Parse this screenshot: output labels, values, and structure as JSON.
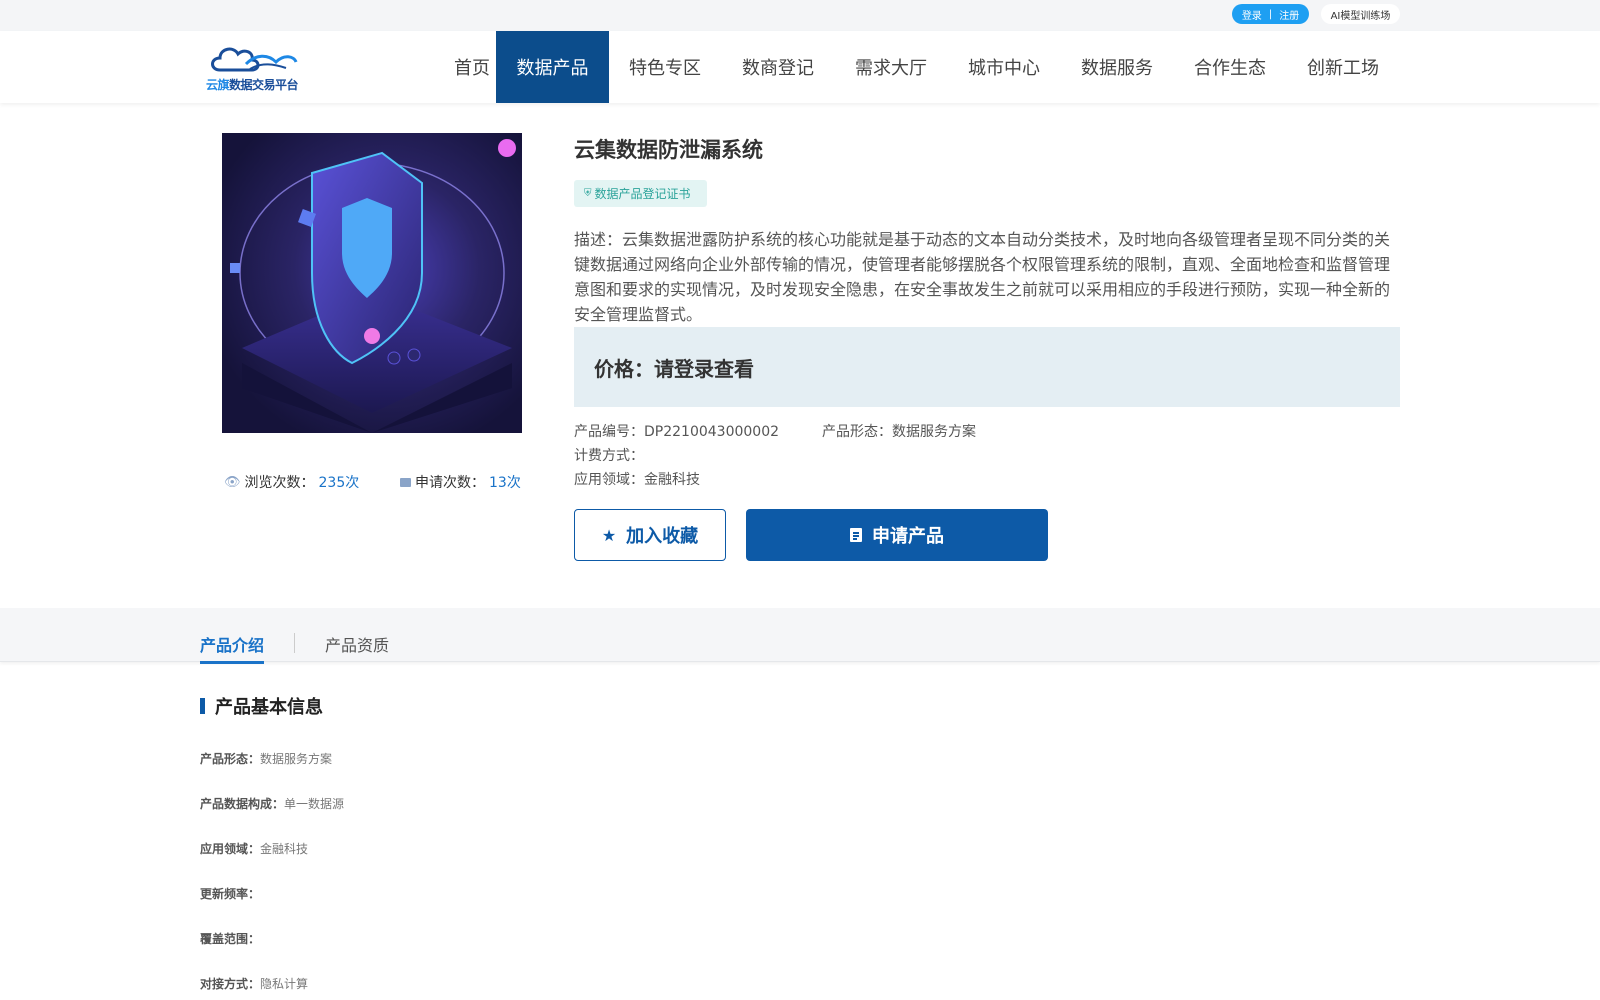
{
  "topbar": {
    "login": "登录",
    "separator": "|",
    "register": "注册",
    "ai_link": "AI模型训练场"
  },
  "logo": {
    "text_accent": "云旗",
    "text_rest": "数据交易平台"
  },
  "nav": {
    "items": [
      "首页",
      "数据产品",
      "特色专区",
      "数商登记",
      "需求大厅",
      "城市中心",
      "数据服务",
      "合作生态",
      "创新工场"
    ],
    "active": "数据产品"
  },
  "product": {
    "title": "云集数据防泄漏系统",
    "cert_label": "数据产品登记证书",
    "description": "描述：云集数据泄露防护系统的核心功能就是基于动态的文本自动分类技术，及时地向各级管理者呈现不同分类的关键数据通过网络向企业外部传输的情况，使管理者能够摆脱各个权限管理系统的限制，直观、全面地检查和监督管理意图和要求的实现情况，及时发现安全隐患，在安全事故发生之前就可以采用相应的手段进行预防，实现一种全新的安全管理监督式。",
    "price_text": "价格：请登录查看",
    "views_label": "浏览次数：",
    "views_value": "235次",
    "applies_label": "申请次数：",
    "applies_value": "13次",
    "code_label": "产品编号：",
    "code_value": "DP2210043000002",
    "form_label": "产品形态：",
    "form_value": "数据服务方案",
    "billing_label": "计费方式：",
    "billing_value": "",
    "domain_label": "应用领域：",
    "domain_value": "金融科技",
    "favorite_btn": "加入收藏",
    "apply_btn": "申请产品"
  },
  "tabs": {
    "intro": "产品介绍",
    "qualification": "产品资质"
  },
  "basic_info": {
    "title": "产品基本信息",
    "rows": [
      {
        "label": "产品形态：",
        "value": "数据服务方案"
      },
      {
        "label": "产品数据构成：",
        "value": "单一数据源"
      },
      {
        "label": "应用领域：",
        "value": "金融科技"
      },
      {
        "label": "更新频率：",
        "value": ""
      },
      {
        "label": "覆盖范围：",
        "value": ""
      },
      {
        "label": "对接方式：",
        "value": "隐私计算"
      }
    ]
  },
  "colors": {
    "primary": "#0d5aa7",
    "nav_active": "#0c4d8c",
    "accent_blue": "#1a73c8",
    "pill_blue": "#1e9ff2",
    "price_bg": "#e4eef3"
  }
}
